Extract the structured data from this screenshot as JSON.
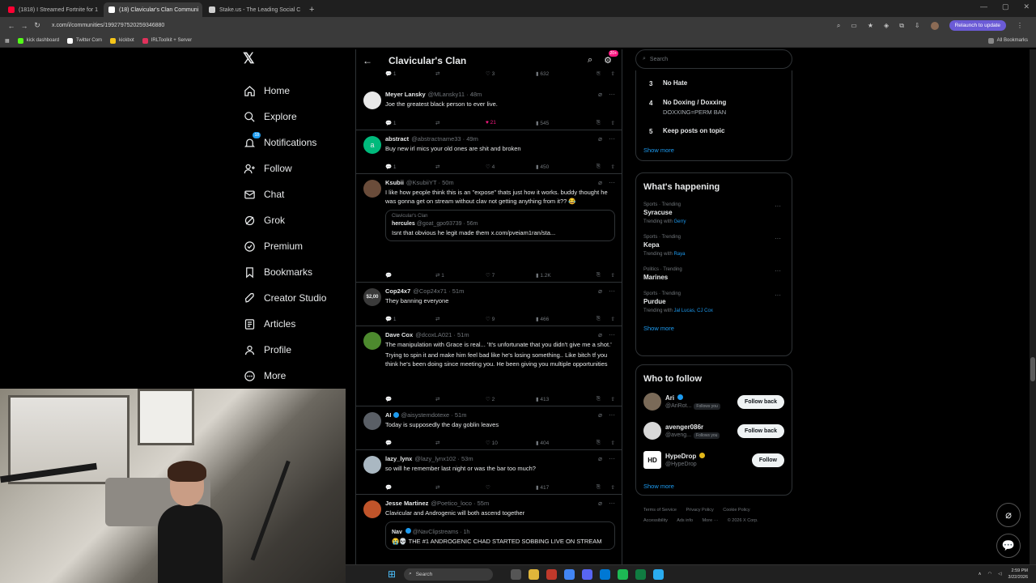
{
  "browser": {
    "tabs": [
      {
        "title": "(1818) I Streamed Fortnite for 1",
        "color": "#ff0033",
        "active": false
      },
      {
        "title": "(18) Clavicular's Clan Communi",
        "color": "#ffffff",
        "active": true
      },
      {
        "title": "Stake.us - The Leading Social C",
        "color": "#d8d8d8",
        "active": false
      }
    ],
    "url": "x.com/i/communities/1992797520259346880",
    "relaunch": "Relaunch to update",
    "bookmarks": [
      "kick dashboard",
      "Twitter Com",
      "kickbot",
      "IRLToolkit + Server"
    ],
    "all_bookmarks": "All Bookmarks"
  },
  "nav": {
    "items": [
      {
        "label": "Home",
        "icon": "home-icon"
      },
      {
        "label": "Explore",
        "icon": "search-icon"
      },
      {
        "label": "Notifications",
        "icon": "bell-icon",
        "badge": "18"
      },
      {
        "label": "Follow",
        "icon": "add-user-icon"
      },
      {
        "label": "Chat",
        "icon": "mail-icon"
      },
      {
        "label": "Grok",
        "icon": "grok-icon"
      },
      {
        "label": "Premium",
        "icon": "premium-icon"
      },
      {
        "label": "Bookmarks",
        "icon": "bookmark-icon"
      },
      {
        "label": "Creator Studio",
        "icon": "rocket-icon"
      },
      {
        "label": "Articles",
        "icon": "article-icon"
      },
      {
        "label": "Profile",
        "icon": "person-icon"
      },
      {
        "label": "More",
        "icon": "more-icon"
      }
    ]
  },
  "feed": {
    "title": "Clavicular's Clan",
    "header_badge": "20+",
    "top_stats": {
      "replies": "1",
      "likes": "3",
      "views": "632"
    },
    "tweets": [
      {
        "name": "Meyer Lansky",
        "handle": "@MLansky11 · 48m",
        "text": "Joe the greatest black person to ever live.",
        "replies": "1",
        "retweets": "",
        "likes": "21",
        "views": "545",
        "liked": true
      },
      {
        "name": "abstract",
        "handle": "@abstractname33 · 49m",
        "text": "Buy new irl mics your old ones are shit and broken",
        "replies": "1",
        "retweets": "",
        "likes": "4",
        "views": "450"
      },
      {
        "name": "Ksubii",
        "handle": "@KsubiiYT · 50m",
        "text": "I like how people think this is an \"expose\" thats just how it works. buddy thought he was gonna get on stream without clav not getting anything from it?? 😂",
        "quote_community": "Clavicular's Clan",
        "quote_name": "hercules",
        "quote_handle": "@goat_gpo93739 · 56m",
        "quote_text": "Isnt that obvious he legit made them x.com/pveiam1ran/sta...",
        "replies": "",
        "retweets": "1",
        "likes": "7",
        "views": "1.2K"
      },
      {
        "name": "Cop24x7",
        "handle": "@Cop24x71 · 51m",
        "avatar_text": "$2,00",
        "text": "They banning everyone",
        "replies": "1",
        "retweets": "",
        "likes": "9",
        "views": "466"
      },
      {
        "name": "Dave Cox",
        "handle": "@dcoxLA021 · 51m",
        "text": "The manipulation with Grace is real... 'It's unfortunate that you didn't give me a shot.'",
        "text2": "Trying to spin it and make him feel bad like he's losing something.. Like bitch tf you think he's been doing since meeting you. He been giving you multiple opportunities",
        "replies": "",
        "retweets": "",
        "likes": "2",
        "views": "413"
      },
      {
        "name": "AI",
        "handle": "@aisystemdotexe · 51m",
        "text": "Today is supposedly the day goblin leaves",
        "replies": "",
        "retweets": "",
        "likes": "10",
        "views": "404"
      },
      {
        "name": "lazy_lynx",
        "handle": "@lazy_lynx102 · 53m",
        "text": "so will he remember last night or was the bar too much?",
        "replies": "",
        "retweets": "",
        "likes": "",
        "views": "417"
      },
      {
        "name": "Jesse Martinez",
        "handle": "@Poetico_loco · 55m",
        "text": "Clavicular and Androgenic will both ascend together",
        "quote_name": "Nav",
        "quote_handle": "@NavClipstreams · 1h",
        "quote_text": "😭💀 THE #1 ANDROGENIC CHAD STARTED SOBBING LIVE ON STREAM"
      }
    ]
  },
  "right": {
    "search_placeholder": "Search",
    "rules": [
      {
        "num": "3",
        "title": "No Hate",
        "sub": ""
      },
      {
        "num": "4",
        "title": "No Doxing / Doxxing",
        "sub": "DOXXING=PERM BAN"
      },
      {
        "num": "5",
        "title": "Keep posts on topic",
        "sub": ""
      }
    ],
    "show_more": "Show more",
    "happening_title": "What's happening",
    "trends": [
      {
        "cat": "Sports · Trending",
        "name": "Syracuse",
        "with_label": "Trending with",
        "with": "Gerry"
      },
      {
        "cat": "Sports · Trending",
        "name": "Kepa",
        "with_label": "Trending with",
        "with": "Raya"
      },
      {
        "cat": "Politics · Trending",
        "name": "Marines",
        "with_label": "",
        "with": ""
      },
      {
        "cat": "Sports · Trending",
        "name": "Purdue",
        "with_label": "Trending with",
        "with": "Jal Lucas, CJ Cox"
      }
    ],
    "wtf_title": "Who to follow",
    "wtf": [
      {
        "name": "Ari",
        "handle": "@AriRot...",
        "follows_you": "Follows you",
        "button": "Follow back",
        "color": "#7a6a58"
      },
      {
        "name": "avenger086r",
        "handle": "@aveng...",
        "follows_you": "Follows you",
        "button": "Follow back",
        "color": "#d8d8d8"
      },
      {
        "name": "HypeDrop",
        "handle": "@HypeDrop",
        "follows_you": "",
        "button": "Follow",
        "color": "#ffffff"
      }
    ],
    "footer": [
      "Terms of Service",
      "Privacy Policy",
      "Cookie Policy",
      "Accessibility",
      "Ads info",
      "More ···",
      "© 2026 X Corp."
    ]
  },
  "taskbar": {
    "search": "Search",
    "time": "2:59 PM",
    "date": "3/22/2026"
  },
  "colors": {
    "accent": "#1d9bf0",
    "like": "#f91880",
    "bg": "#000000"
  }
}
